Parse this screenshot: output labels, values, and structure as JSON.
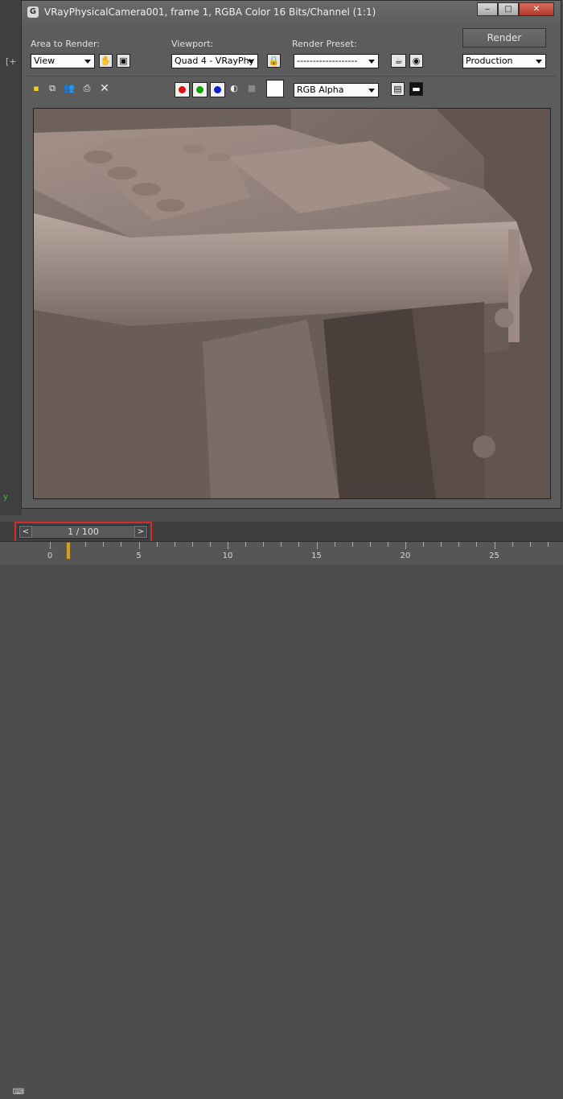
{
  "window": {
    "title": "VRayPhysicalCamera001, frame 1, RGBA Color 16 Bits/Channel (1:1)",
    "icon": "3ds-max-icon",
    "buttons": {
      "minimize": "‒",
      "maximize": "□",
      "close": "✕"
    }
  },
  "controls": {
    "area_to_render_label": "Area to Render:",
    "area_to_render_value": "View",
    "viewport_label": "Viewport:",
    "viewport_value": "Quad 4 - VRayPhy",
    "render_preset_label": "Render Preset:",
    "render_preset_value": "-------------------",
    "render_button": "Render",
    "production_value": "Production"
  },
  "toolbar": {
    "channel_value": "RGB Alpha",
    "colors": {
      "red": "#e01010",
      "green": "#10a010",
      "blue": "#1020d0"
    }
  },
  "timeline": {
    "frame_counter": "1 / 100",
    "prev": "<",
    "next": ">",
    "ruler_labels": [
      "0",
      "5",
      "10",
      "15",
      "20",
      "25"
    ]
  },
  "viewport_side": {
    "plus": "[+",
    "axis": "y"
  }
}
